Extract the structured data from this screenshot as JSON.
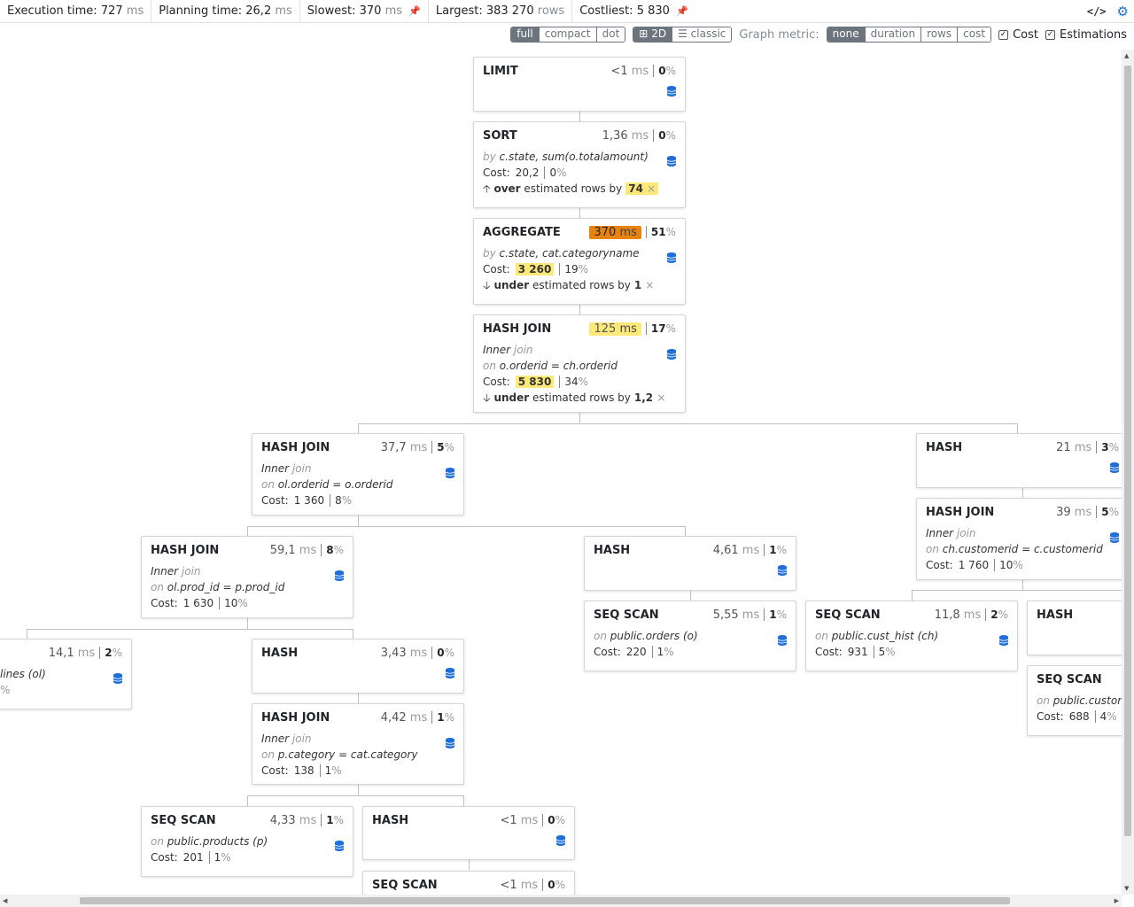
{
  "stats": {
    "execution": {
      "label": "Execution time:",
      "value": "727",
      "unit": "ms"
    },
    "planning": {
      "label": "Planning time:",
      "value": "26,2",
      "unit": "ms"
    },
    "slowest": {
      "label": "Slowest:",
      "value": "370",
      "unit": "ms"
    },
    "largest": {
      "label": "Largest:",
      "value": "383 270",
      "unit": "rows"
    },
    "costliest": {
      "label": "Costliest:",
      "value": "5 830"
    }
  },
  "toolbar": {
    "layout": [
      "full",
      "compact",
      "dot"
    ],
    "layout_active": "full",
    "view": [
      "2D",
      "classic"
    ],
    "view_active": "2D",
    "metric_label": "Graph metric:",
    "metrics": [
      "none",
      "duration",
      "rows",
      "cost"
    ],
    "metric_active": "none",
    "cost_label": "Cost",
    "estimations_label": "Estimations"
  },
  "labels": {
    "by": "by",
    "on": "on",
    "join": "join",
    "cost": "Cost:",
    "over": "over",
    "under": "under",
    "estimated": "estimated rows by",
    "times": "×"
  },
  "nodes": {
    "limit": {
      "title": "LIMIT",
      "duration": "<1",
      "unit": "ms",
      "pct": "0"
    },
    "sort": {
      "title": "SORT",
      "duration": "1,36",
      "unit": "ms",
      "pct": "0",
      "by": "c.state, sum(o.totalamount)",
      "cost": "20,2",
      "cost_pct": "0",
      "est_dir": "over",
      "est_factor": "74"
    },
    "aggregate": {
      "title": "AGGREGATE",
      "duration": "370",
      "unit": "ms",
      "pct": "51",
      "by": "c.state, cat.categoryname",
      "cost": "3 260",
      "cost_pct": "19",
      "est_dir": "under",
      "est_factor": "1"
    },
    "hashjoin1": {
      "title": "HASH JOIN",
      "duration": "125",
      "unit": "ms",
      "pct": "17",
      "join_type": "Inner",
      "on": "o.orderid = ch.orderid",
      "cost": "5 830",
      "cost_pct": "34",
      "est_dir": "under",
      "est_factor": "1,2"
    },
    "hashjoin2": {
      "title": "HASH JOIN",
      "duration": "37,7",
      "unit": "ms",
      "pct": "5",
      "join_type": "Inner",
      "on": "ol.orderid = o.orderid",
      "cost": "1 360",
      "cost_pct": "8"
    },
    "hash_r1": {
      "title": "HASH",
      "duration": "21",
      "unit": "ms",
      "pct": "3"
    },
    "hashjoin_r": {
      "title": "HASH JOIN",
      "duration": "39",
      "unit": "ms",
      "pct": "5",
      "join_type": "Inner",
      "on": "ch.customerid = c.customerid",
      "cost": "1 760",
      "cost_pct": "10"
    },
    "hashjoin3": {
      "title": "HASH JOIN",
      "duration": "59,1",
      "unit": "ms",
      "pct": "8",
      "join_type": "Inner",
      "on": "ol.prod_id = p.prod_id",
      "cost": "1 630",
      "cost_pct": "10"
    },
    "hash_m": {
      "title": "HASH",
      "duration": "4,61",
      "unit": "ms",
      "pct": "1"
    },
    "seqscan_orders": {
      "title": "SEQ SCAN",
      "duration": "5,55",
      "unit": "ms",
      "pct": "1",
      "on": "public.orders (o)",
      "cost": "220",
      "cost_pct": "1"
    },
    "seqscan_custhist": {
      "title": "SEQ SCAN",
      "duration": "11,8",
      "unit": "ms",
      "pct": "2",
      "on": "public.cust_hist (ch)",
      "cost": "931",
      "cost_pct": "5"
    },
    "hash_r2": {
      "title": "HASH"
    },
    "seqscan_customers": {
      "title": "SEQ SCAN",
      "on": "public.custome",
      "cost": "688",
      "cost_pct": "4"
    },
    "seqscan_orderlines": {
      "duration": "14,1",
      "unit": "ms",
      "pct": "2",
      "on": "lines (ol)",
      "cost_pct_tail": "%"
    },
    "hash_l": {
      "title": "HASH",
      "duration": "3,43",
      "unit": "ms",
      "pct": "0"
    },
    "hashjoin4": {
      "title": "HASH JOIN",
      "duration": "4,42",
      "unit": "ms",
      "pct": "1",
      "join_type": "Inner",
      "on": "p.category = cat.category",
      "cost": "138",
      "cost_pct": "1"
    },
    "seqscan_products": {
      "title": "SEQ SCAN",
      "duration": "4,33",
      "unit": "ms",
      "pct": "1",
      "on": "public.products (p)",
      "cost": "201",
      "cost_pct": "1"
    },
    "hash_b": {
      "title": "HASH",
      "duration": "<1",
      "unit": "ms",
      "pct": "0"
    },
    "seqscan_b": {
      "title": "SEQ SCAN",
      "duration": "<1",
      "unit": "ms",
      "pct": "0"
    }
  },
  "colors": {
    "accent": "#1e6fd9",
    "highlight": "#fce97a",
    "slowest": "#e8830f",
    "button": "#6c757d"
  }
}
